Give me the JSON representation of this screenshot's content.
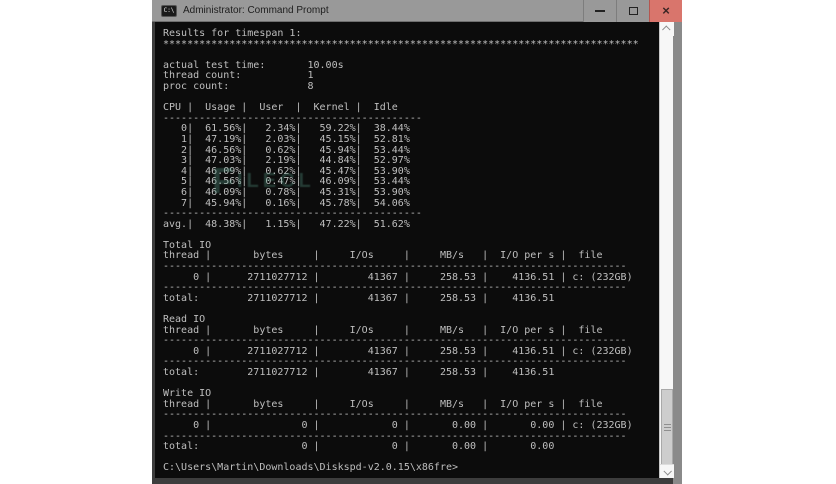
{
  "window": {
    "title": "Administrator: Command Prompt",
    "icon_label": "C:\\",
    "controls": {
      "minimize": "minimize",
      "maximize": "maximize",
      "close": "close",
      "close_glyph": "×"
    }
  },
  "terminal": {
    "prompt": "C:\\Users\\Martin\\Downloads\\Diskspd-v2.0.15\\x86fre>",
    "lines": [
      "Results for timespan 1:",
      "*******************************************************************************",
      "",
      "actual test time:       10.00s",
      "thread count:           1",
      "proc count:             8",
      "",
      "CPU |  Usage |  User  |  Kernel |  Idle",
      "-------------------------------------------",
      "   0|  61.56%|   2.34%|   59.22%|  38.44%",
      "   1|  47.19%|   2.03%|   45.15%|  52.81%",
      "   2|  46.56%|   0.62%|   45.94%|  53.44%",
      "   3|  47.03%|   2.19%|   44.84%|  52.97%",
      "   4|  46.09%|   0.62%|   45.47%|  53.90%",
      "   5|  46.56%|   0.47%|   46.09%|  53.44%",
      "   6|  46.09%|   0.78%|   45.31%|  53.90%",
      "   7|  45.94%|   0.16%|   45.78%|  54.06%",
      "-------------------------------------------",
      "avg.|  48.38%|   1.15%|   47.22%|  51.62%",
      "",
      "Total IO",
      "thread |       bytes     |     I/Os     |     MB/s   |  I/O per s |  file",
      "-----------------------------------------------------------------------------",
      "     0 |      2711027712 |        41367 |     258.53 |    4136.51 | c: (232GB)",
      "-----------------------------------------------------------------------------",
      "total:        2711027712 |        41367 |     258.53 |    4136.51",
      "",
      "Read IO",
      "thread |       bytes     |     I/Os     |     MB/s   |  I/O per s |  file",
      "-----------------------------------------------------------------------------",
      "     0 |      2711027712 |        41367 |     258.53 |    4136.51 | c: (232GB)",
      "-----------------------------------------------------------------------------",
      "total:        2711027712 |        41367 |     258.53 |    4136.51",
      "",
      "Write IO",
      "thread |       bytes     |     I/Os     |     MB/s   |  I/O per s |  file",
      "-----------------------------------------------------------------------------",
      "     0 |               0 |            0 |       0.00 |       0.00 | c: (232GB)",
      "-----------------------------------------------------------------------------",
      "total:                 0 |            0 |       0.00 |       0.00",
      "",
      "C:\\Users\\Martin\\Downloads\\Diskspd-v2.0.15\\x86fre>"
    ],
    "results": {
      "timespan": 1,
      "actual_test_time": "10.00s",
      "thread_count": 1,
      "proc_count": 8,
      "cpu_table": {
        "headers": [
          "CPU",
          "Usage",
          "User",
          "Kernel",
          "Idle"
        ],
        "rows": [
          [
            "0",
            "61.56%",
            "2.34%",
            "59.22%",
            "38.44%"
          ],
          [
            "1",
            "47.19%",
            "2.03%",
            "45.15%",
            "52.81%"
          ],
          [
            "2",
            "46.56%",
            "0.62%",
            "45.94%",
            "53.44%"
          ],
          [
            "3",
            "47.03%",
            "2.19%",
            "44.84%",
            "52.97%"
          ],
          [
            "4",
            "46.09%",
            "0.62%",
            "45.47%",
            "53.90%"
          ],
          [
            "5",
            "46.56%",
            "0.47%",
            "46.09%",
            "53.44%"
          ],
          [
            "6",
            "46.09%",
            "0.78%",
            "45.31%",
            "53.90%"
          ],
          [
            "7",
            "45.94%",
            "0.16%",
            "45.78%",
            "54.06%"
          ],
          [
            "avg.",
            "48.38%",
            "1.15%",
            "47.22%",
            "51.62%"
          ]
        ]
      },
      "io_tables": [
        {
          "title": "Total IO",
          "headers": [
            "thread",
            "bytes",
            "I/Os",
            "MB/s",
            "I/O per s",
            "file"
          ],
          "rows": [
            [
              "0",
              "2711027712",
              "41367",
              "258.53",
              "4136.51",
              "c: (232GB)"
            ]
          ],
          "total": [
            "2711027712",
            "41367",
            "258.53",
            "4136.51"
          ]
        },
        {
          "title": "Read IO",
          "headers": [
            "thread",
            "bytes",
            "I/Os",
            "MB/s",
            "I/O per s",
            "file"
          ],
          "rows": [
            [
              "0",
              "2711027712",
              "41367",
              "258.53",
              "4136.51",
              "c: (232GB)"
            ]
          ],
          "total": [
            "2711027712",
            "41367",
            "258.53",
            "4136.51"
          ]
        },
        {
          "title": "Write IO",
          "headers": [
            "thread",
            "bytes",
            "I/Os",
            "MB/s",
            "I/O per s",
            "file"
          ],
          "rows": [
            [
              "0",
              "0",
              "0",
              "0.00",
              "0.00",
              "c: (232GB)"
            ]
          ],
          "total": [
            "0",
            "0",
            "0.00",
            "0.00"
          ]
        }
      ]
    }
  },
  "watermark": {
    "big": "F",
    "small": "ILECL"
  },
  "colors": {
    "titlebar_gray": "#999999",
    "close_red": "#d9756c",
    "terminal_bg": "#0c0c0c",
    "terminal_fg": "#bfbfbf",
    "frame_dark": "#3d3d3d",
    "frame_light": "#8a8a8a",
    "scroll_track": "#f7f7f7",
    "scroll_thumb": "#cdcdcd",
    "watermark": "#5aa08c"
  }
}
